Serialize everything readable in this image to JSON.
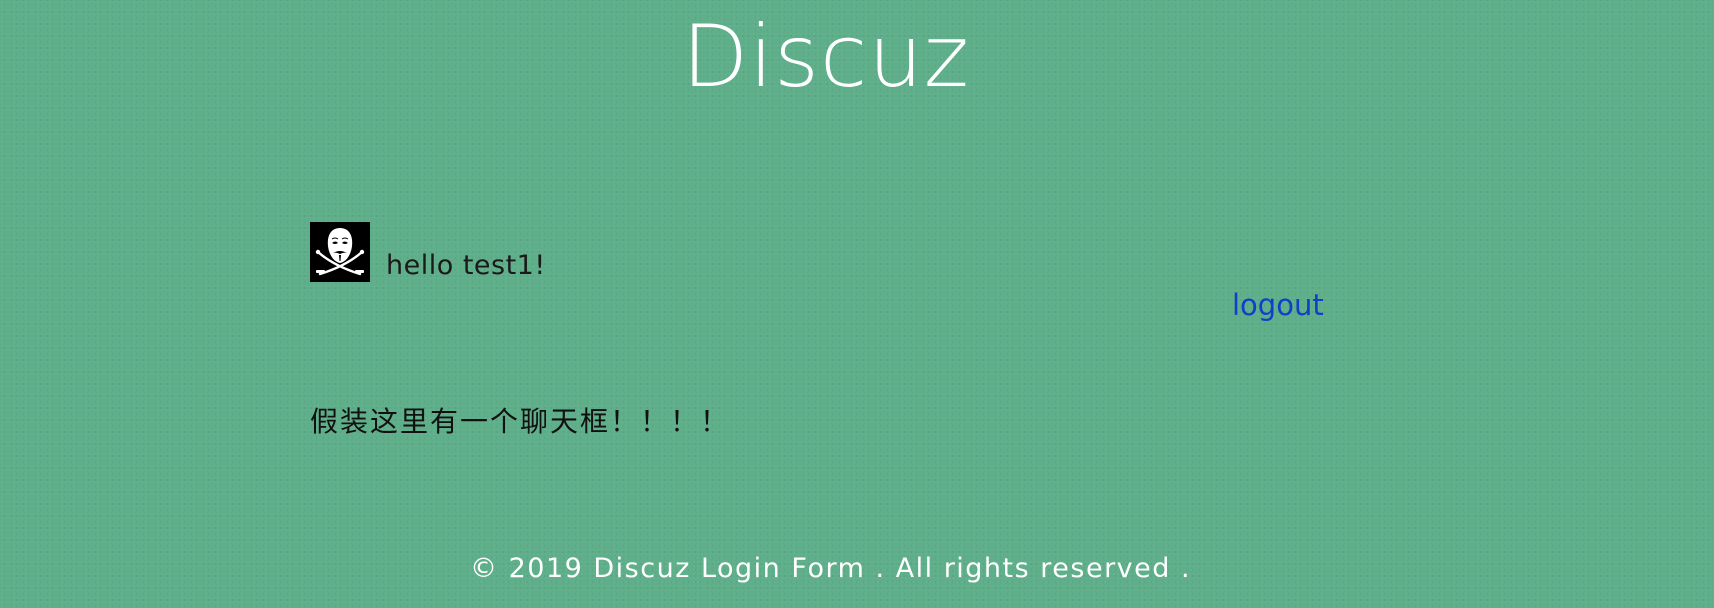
{
  "header": {
    "title": "Discuz"
  },
  "user": {
    "greeting": "hello test1!",
    "avatar_icon": "pirate-mask-icon",
    "logout_label": "logout"
  },
  "main": {
    "chat_placeholder": "假装这里有一个聊天框！！！！"
  },
  "footer": {
    "text": "© 2019 Discuz Login Form . All rights reserved ."
  },
  "colors": {
    "background": "#5eae8a",
    "title": "#ffffff",
    "link": "#1040c8",
    "text": "#111111"
  }
}
